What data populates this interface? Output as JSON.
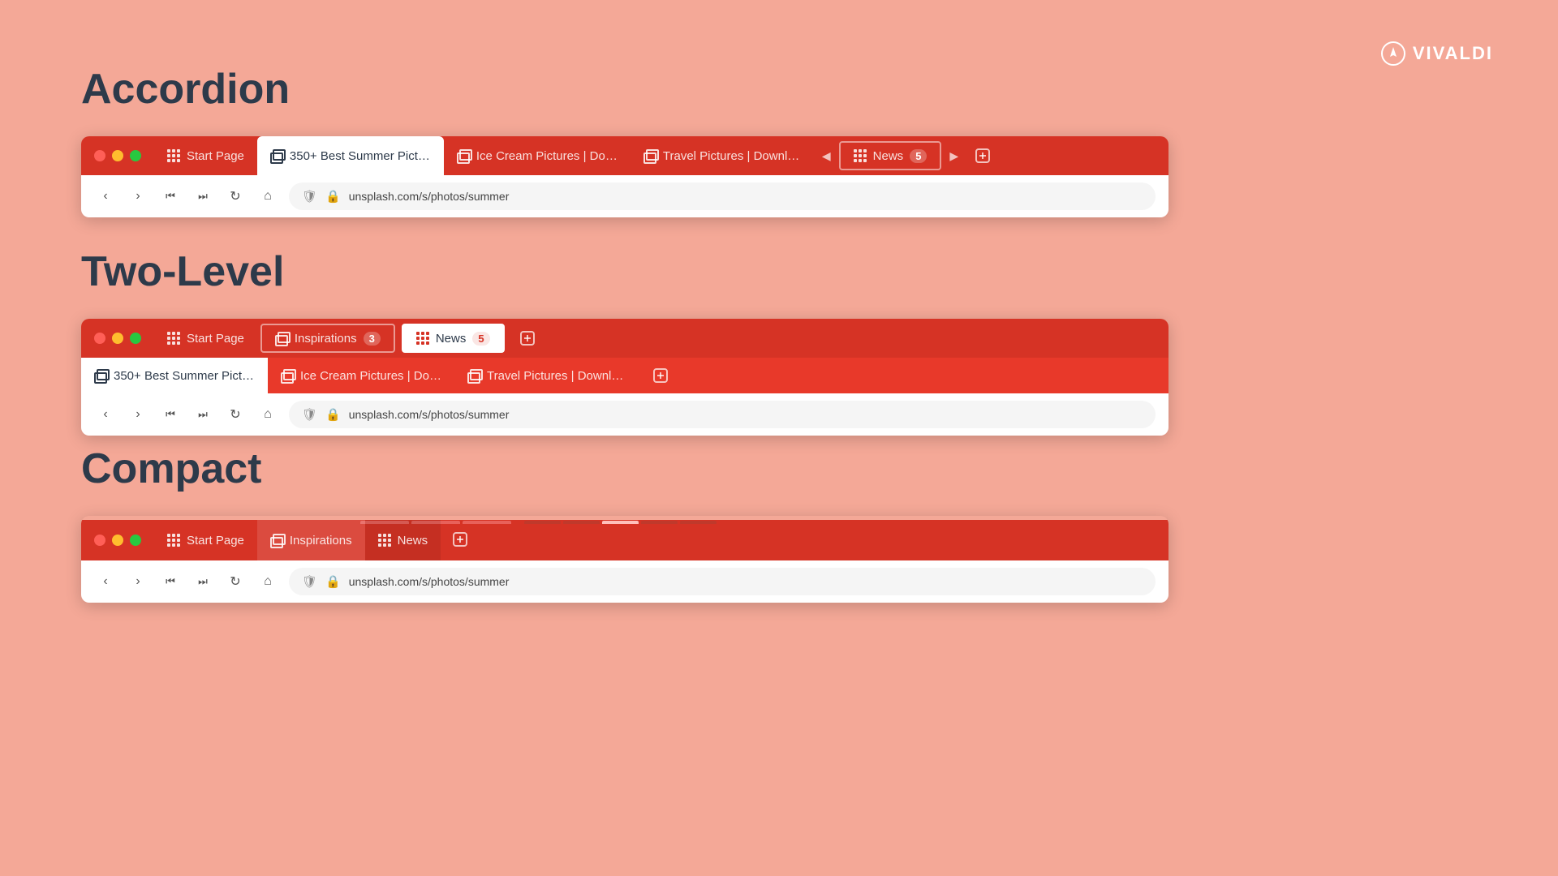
{
  "brand": {
    "name": "VIVALDI"
  },
  "sections": {
    "accordion": {
      "heading": "Accordion",
      "tabs": [
        {
          "id": "start",
          "label": "Start Page",
          "icon": "grid",
          "active": false
        },
        {
          "id": "summer",
          "label": "350+ Best Summer Pictur…",
          "icon": "page",
          "active": true
        },
        {
          "id": "icecream",
          "label": "Ice Cream Pictures | Down",
          "icon": "stack",
          "active": false
        },
        {
          "id": "travel",
          "label": "Travel Pictures | Download",
          "icon": "stack",
          "active": false
        },
        {
          "id": "news",
          "label": "News",
          "icon": "grid",
          "count": "5",
          "active": false,
          "isStack": true
        }
      ],
      "url": "unsplash.com/s/photos/summer"
    },
    "twolevel": {
      "heading": "Two-Level",
      "topTabs": [
        {
          "id": "start",
          "label": "Start Page",
          "icon": "grid",
          "active": false
        },
        {
          "id": "inspirations",
          "label": "Inspirations",
          "icon": "stack",
          "count": "3",
          "active": false
        },
        {
          "id": "news",
          "label": "News",
          "icon": "grid",
          "count": "5",
          "active": true
        }
      ],
      "bottomTabs": [
        {
          "id": "summer",
          "label": "350+ Best Summer Pictur…",
          "icon": "page",
          "active": true
        },
        {
          "id": "icecream",
          "label": "Ice Cream Pictures | Down",
          "icon": "stack",
          "active": false
        },
        {
          "id": "travel",
          "label": "Travel Pictures | Download",
          "icon": "stack",
          "active": false
        }
      ],
      "url": "unsplash.com/s/photos/summer"
    },
    "compact": {
      "heading": "Compact",
      "tabs": [
        {
          "id": "start",
          "label": "Start Page",
          "icon": "grid",
          "active": false
        },
        {
          "id": "inspirations",
          "label": "Inspirations",
          "icon": "stack",
          "active": false,
          "hasSubTabs": true,
          "subColor": "#e8392a"
        },
        {
          "id": "news",
          "label": "News",
          "icon": "grid",
          "active": false,
          "hasSubTabs": true,
          "subColor": "#d63325"
        }
      ],
      "url": "unsplash.com/s/photos/summer"
    }
  },
  "nav": {
    "back": "‹",
    "forward": "›",
    "rewind": "«",
    "fastforward": "»",
    "reload": "↻",
    "home": "⌂"
  }
}
